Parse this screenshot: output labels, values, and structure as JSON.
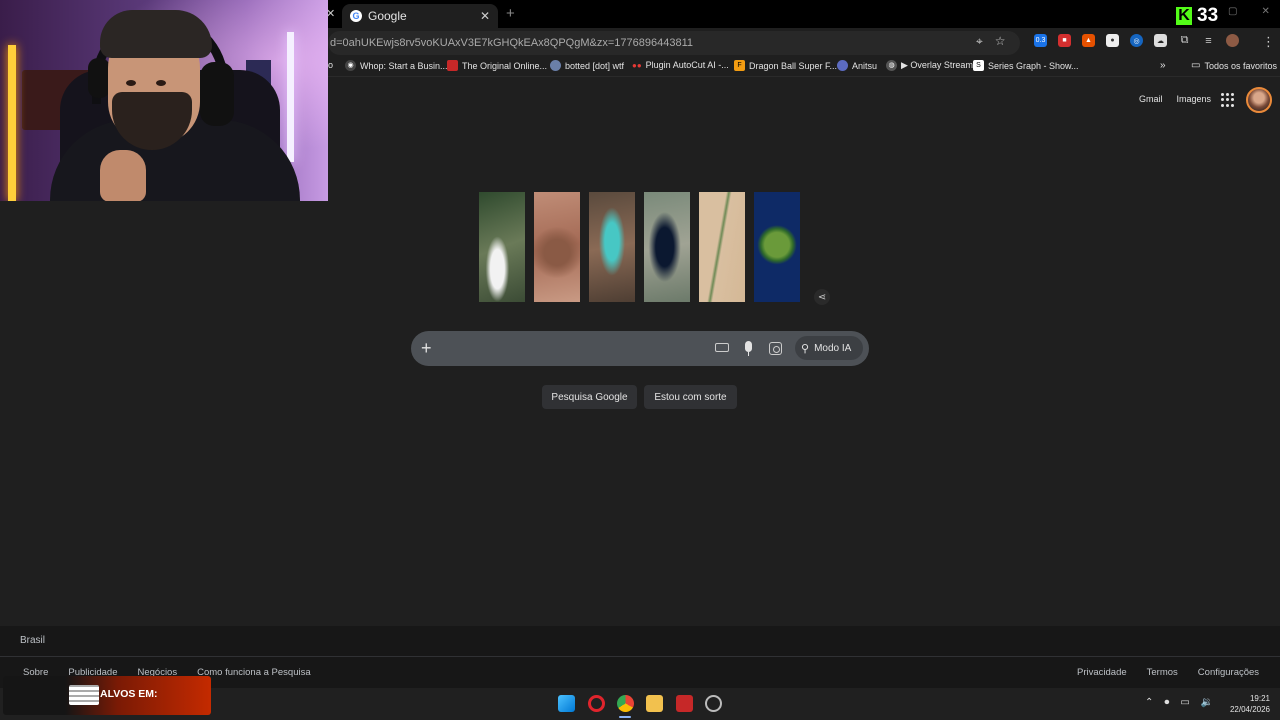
{
  "browser": {
    "tab_title": "Google",
    "url": "d=0ahUKEwjs8rv5voKUAxV3E7kGHQkEAx8QPQgM&zx=1776896443811",
    "bookmarks": [
      {
        "label": "o",
        "icon": "partial-bookmark"
      },
      {
        "label": "Whop: Start a Busin...",
        "icon": "whop-icon"
      },
      {
        "label": "The Original Online...",
        "icon": "red-flag-icon"
      },
      {
        "label": "botted [dot] wtf",
        "icon": "bot-icon"
      },
      {
        "label": "Plugin AutoCut AI -...",
        "icon": "dots-icon"
      },
      {
        "label": "Dragon Ball Super F...",
        "icon": "f-icon"
      },
      {
        "label": "Anitsu",
        "icon": "anime-icon"
      },
      {
        "label": "▶ Overlay Stream",
        "icon": "globe-icon"
      },
      {
        "label": "Series Graph - Show...",
        "icon": "s-icon"
      }
    ],
    "more_bookmarks": "»",
    "all_favorites": "Todos os favoritos"
  },
  "kick": {
    "count": "33"
  },
  "google": {
    "top_links": [
      "Gmail",
      "Imagens"
    ],
    "search_placeholder": "",
    "ai_mode_label": "Modo IA",
    "btn_search": "Pesquisa Google",
    "btn_lucky": "Estou com sorte"
  },
  "footer": {
    "country": "Brasil",
    "left_links": [
      "Sobre",
      "Publicidade",
      "Negócios",
      "Como funciona a Pesquisa"
    ],
    "right_links": [
      "Privacidade",
      "Termos",
      "Configurações"
    ]
  },
  "stream_banner": {
    "text": "ALVOS EM:"
  },
  "taskbar": {
    "time": "19:21",
    "date": "22/04/2026"
  },
  "colors": {
    "page_bg": "#1f1f1f",
    "search_bg": "#4d5156",
    "kick_green": "#53fc18"
  }
}
